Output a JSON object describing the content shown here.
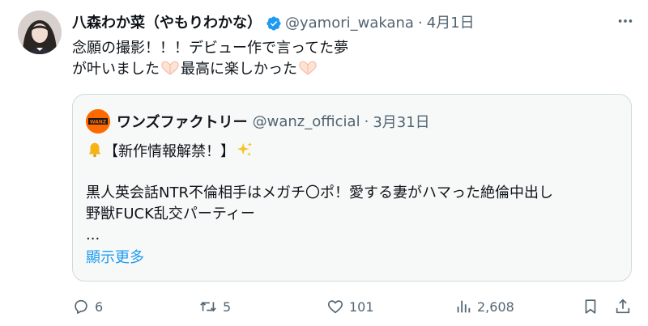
{
  "author": {
    "display_name": "八森わか菜（やもりわかな）",
    "handle": "@yamori_wakana",
    "separator": "·",
    "time": "4月1日"
  },
  "tweet": {
    "line1": "念願の撮影！！！デビュー作で言ってた夢",
    "line2_start": "が叶いました",
    "line2_middle": "最高に楽しかった"
  },
  "quote": {
    "display_name": "ワンズファクトリー",
    "handle": "@wanz_official",
    "separator": "·",
    "time": "3月31日",
    "headline": "【新作情報解禁！】",
    "body_line1": "黒人英会話NTR不倫相手はメガチ〇ポ！愛する妻がハマった絶倫中出し",
    "body_line2": "野獣FUCK乱交パーティー",
    "ellipsis": "...",
    "show_more": "顯示更多",
    "avatar_text": "WANZ"
  },
  "metrics": {
    "replies": "6",
    "reposts": "5",
    "likes": "101",
    "views": "2,608"
  },
  "icons": {
    "verified": "verified-badge-icon",
    "more": "more-icon",
    "reply": "reply-icon",
    "repost": "repost-icon",
    "like": "like-icon",
    "views": "views-icon",
    "bookmark": "bookmark-icon",
    "share": "share-icon",
    "bell": "bell-icon",
    "sparkles": "sparkles-icon",
    "heart_hands": "heart-hands-icon"
  },
  "colors": {
    "text": "#0f1419",
    "secondary": "#536471",
    "link": "#1d9bf0",
    "card_bg": "#f7f9f9",
    "border": "#cfd9de"
  }
}
